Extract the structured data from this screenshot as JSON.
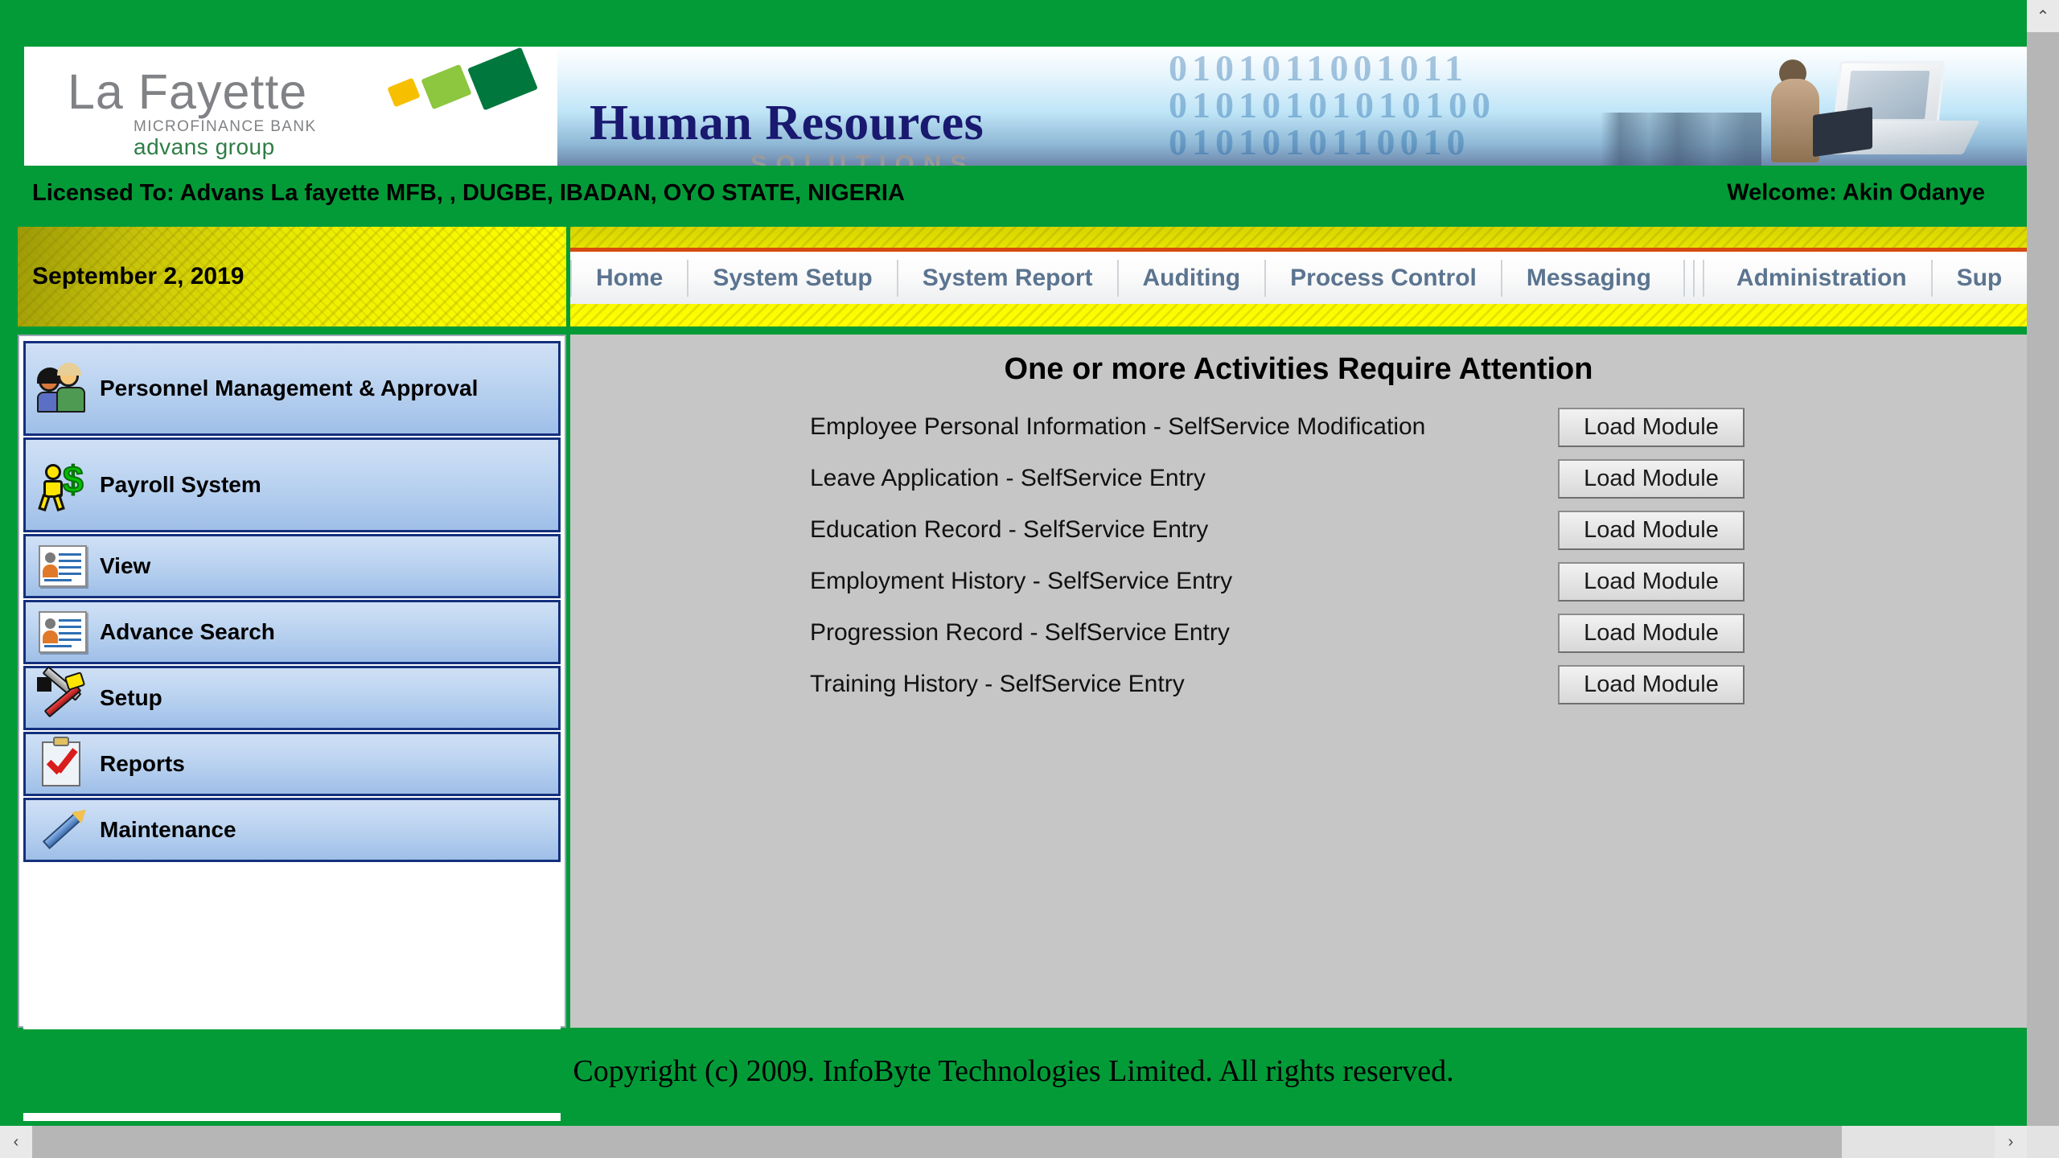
{
  "brand": {
    "logo_word": "La Fayette",
    "logo_sub1": "MICROFINANCE BANK",
    "logo_sub2": "advans group",
    "banner_title": "Human Resources",
    "banner_subtitle": "SOLUTIONS",
    "banner_binary": "0101011001011\n01010101010100\n0101010110010",
    "green": "#039b38",
    "navy": "#191970"
  },
  "license": {
    "licensed_to": "Licensed To: Advans La fayette MFB, , DUGBE, IBADAN, OYO STATE, NIGERIA",
    "welcome": "Welcome: Akin Odanye"
  },
  "datebar": {
    "date": "September 2, 2019"
  },
  "nav": {
    "items": [
      {
        "label": "Home"
      },
      {
        "label": "System Setup"
      },
      {
        "label": "System Report"
      },
      {
        "label": "Auditing"
      },
      {
        "label": "Process Control"
      },
      {
        "label": "Messaging"
      },
      {
        "label": "Administration"
      },
      {
        "label": "Sup"
      }
    ]
  },
  "sidebar": {
    "items": [
      {
        "label": "Personnel Management & Approval",
        "icon": "people-icon"
      },
      {
        "label": "Payroll System",
        "icon": "payroll-money-icon"
      },
      {
        "label": "View",
        "icon": "id-card-icon"
      },
      {
        "label": "Advance Search",
        "icon": "id-card-icon"
      },
      {
        "label": "Setup",
        "icon": "tools-icon"
      },
      {
        "label": "Reports",
        "icon": "clipboard-check-icon"
      },
      {
        "label": "Maintenance",
        "icon": "pencil-icon"
      }
    ]
  },
  "main": {
    "title": "One or more Activities Require Attention",
    "button_label": "Load Module",
    "activities": [
      {
        "label": "Employee Personal Information - SelfService Modification",
        "button": "Load Module"
      },
      {
        "label": "Leave Application - SelfService Entry",
        "button": "Load Module"
      },
      {
        "label": "Education Record - SelfService Entry",
        "button": "Load Module"
      },
      {
        "label": "Employment History - SelfService Entry",
        "button": "Load Module"
      },
      {
        "label": "Progression Record - SelfService Entry",
        "button": "Load Module"
      },
      {
        "label": "Training History - SelfService Entry",
        "button": "Load Module"
      }
    ]
  },
  "footer": {
    "copyright": "Copyright (c) 2009. InfoByte Technologies Limited. All rights reserved."
  },
  "scroll": {
    "up_arrow": "⌃",
    "left_arrow": "‹",
    "right_arrow": "›"
  }
}
